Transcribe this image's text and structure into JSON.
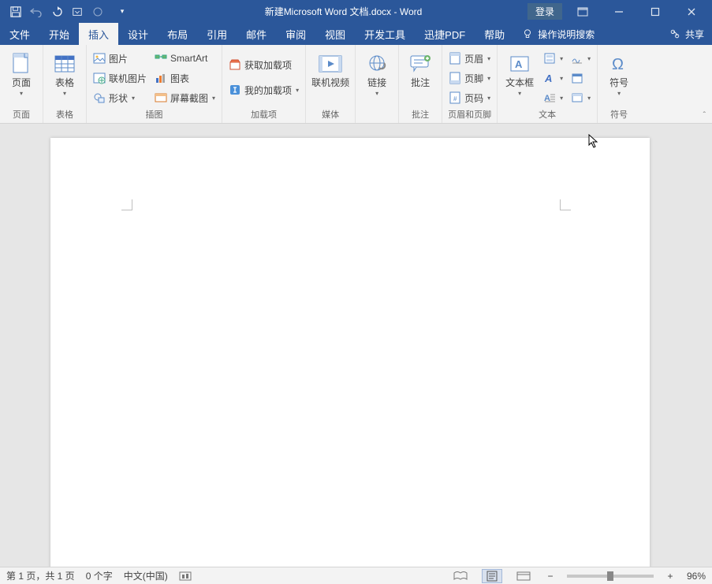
{
  "title": {
    "doc": "新建Microsoft Word 文档.docx",
    "sep": " - ",
    "app": "Word"
  },
  "titlebar": {
    "login": "登录"
  },
  "tabs": {
    "file": "文件",
    "home": "开始",
    "insert": "插入",
    "design": "设计",
    "layout": "布局",
    "references": "引用",
    "mailings": "邮件",
    "review": "审阅",
    "view": "视图",
    "developer": "开发工具",
    "xunjie": "迅捷PDF",
    "help": "帮助",
    "tellme": "操作说明搜索",
    "share": "共享"
  },
  "ribbon": {
    "pages": {
      "label": "页面",
      "button": "页面"
    },
    "tables": {
      "label": "表格",
      "button": "表格"
    },
    "illustrations": {
      "label": "插图",
      "pictures": "图片",
      "online_pictures": "联机图片",
      "shapes": "形状",
      "smartart": "SmartArt",
      "chart": "图表",
      "screenshot": "屏幕截图"
    },
    "addins": {
      "label": "加载项",
      "get": "获取加载项",
      "my": "我的加载项"
    },
    "media": {
      "label": "媒体",
      "online_video": "联机视频"
    },
    "links": {
      "label": "",
      "link": "链接"
    },
    "comments": {
      "label": "批注",
      "comment": "批注"
    },
    "headerfooter": {
      "label": "页眉和页脚",
      "header": "页眉",
      "footer": "页脚",
      "page_number": "页码"
    },
    "text": {
      "label": "文本",
      "text_box": "文本框"
    },
    "symbols": {
      "label": "符号",
      "symbol": "符号"
    }
  },
  "status": {
    "page": "第 1 页，共 1 页",
    "words": "0 个字",
    "language": "中文(中国)",
    "zoom": "96%"
  }
}
